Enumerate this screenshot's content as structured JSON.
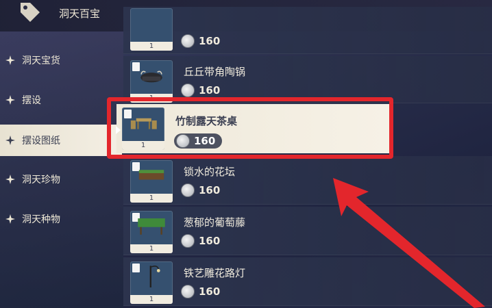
{
  "header": {
    "title": "洞天百宝",
    "icon": "price-tag-icon"
  },
  "sidebar": {
    "items": [
      {
        "label": "洞天宝货",
        "icon": "sparkle-icon",
        "active": false
      },
      {
        "label": "摆设",
        "icon": "sparkle-icon",
        "active": false
      },
      {
        "label": "摆设图纸",
        "icon": "sparkle-icon",
        "active": true
      },
      {
        "label": "洞天珍物",
        "icon": "sparkle-icon",
        "active": false
      },
      {
        "label": "洞天种物",
        "icon": "sparkle-icon",
        "active": false
      }
    ]
  },
  "list": {
    "items": [
      {
        "name": "",
        "qty": "1",
        "price": "160",
        "selected": false
      },
      {
        "name": "丘丘带角陶锅",
        "qty": "1",
        "price": "160",
        "selected": false
      },
      {
        "name": "竹制露天茶桌",
        "qty": "1",
        "price": "160",
        "selected": true
      },
      {
        "name": "锁水的花坛",
        "qty": "1",
        "price": "160",
        "selected": false
      },
      {
        "name": "葱郁的葡萄藤",
        "qty": "1",
        "price": "160",
        "selected": false
      },
      {
        "name": "铁艺雕花路灯",
        "qty": "1",
        "price": "160",
        "selected": false
      }
    ]
  },
  "colors": {
    "highlight": "#e3262c",
    "selected_bg": "#efe9da"
  }
}
